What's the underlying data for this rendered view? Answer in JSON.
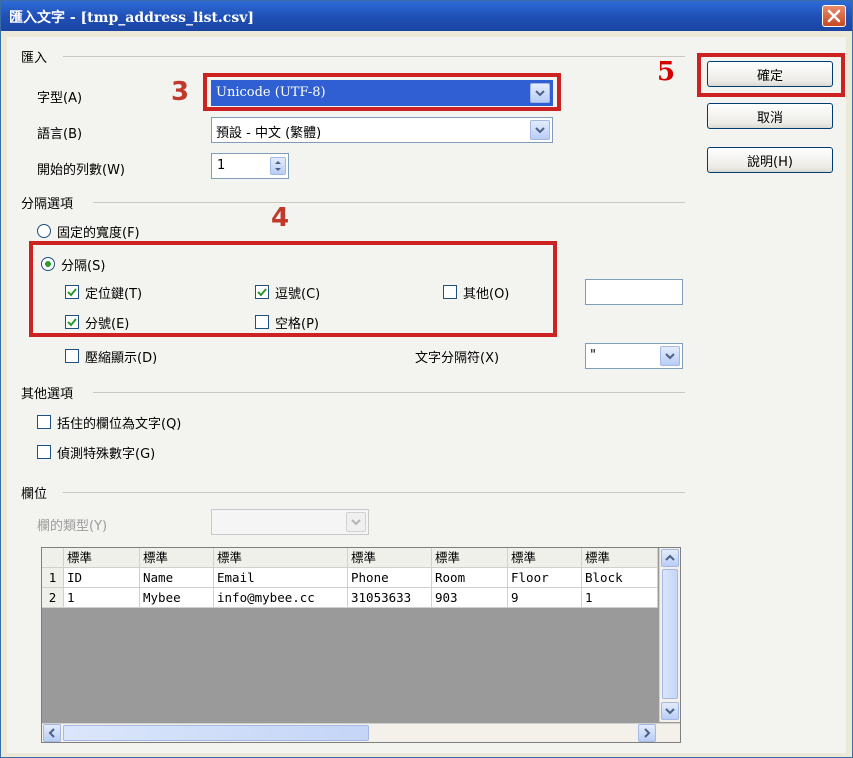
{
  "window": {
    "title": "匯入文字 - [tmp_address_list.csv]",
    "close_icon": "close-icon"
  },
  "import_section": {
    "label": "匯入",
    "charset_label": "字型(A)",
    "charset_value": "Unicode (UTF-8)",
    "language_label": "語言(B)",
    "language_value": "預設 - 中文 (繁體)",
    "from_row_label": "開始的列數(W)",
    "from_row_value": "1"
  },
  "separator_section": {
    "label": "分隔選項",
    "fixed_width_label": "固定的寬度(F)",
    "separated_by_label": "分隔(S)",
    "tab_label": "定位鍵(T)",
    "comma_label": "逗號(C)",
    "other_label": "其他(O)",
    "semicolon_label": "分號(E)",
    "space_label": "空格(P)",
    "merge_label": "壓縮顯示(D)",
    "text_delimiter_label": "文字分隔符(X)",
    "text_delimiter_value": "\"",
    "other_value": "",
    "states": {
      "fixed_width": false,
      "separated_by": true,
      "tab": true,
      "comma": true,
      "other": false,
      "semicolon": true,
      "space": false,
      "merge": false
    }
  },
  "other_options": {
    "label": "其他選項",
    "quoted_as_text_label": "括住的欄位為文字(Q)",
    "detect_special_label": "偵測特殊數字(G)",
    "states": {
      "quoted_as_text": false,
      "detect_special": false
    }
  },
  "fields": {
    "label": "欄位",
    "column_type_label": "欄的類型(Y)",
    "column_type_value": ""
  },
  "buttons": {
    "ok": "確定",
    "cancel": "取消",
    "help": "說明(H)"
  },
  "annotations": {
    "n3": "3",
    "n4": "4",
    "n5": "5"
  },
  "preview": {
    "headers": [
      "標準",
      "標準",
      "標準",
      "標準",
      "標準",
      "標準",
      "標準"
    ],
    "rows": [
      {
        "num": "1",
        "cells": [
          "ID",
          "Name",
          "Email",
          "Phone",
          "Room",
          "Floor",
          "Block"
        ]
      },
      {
        "num": "2",
        "cells": [
          "1",
          "Mybee",
          "info@mybee.cc",
          "31053633",
          "903",
          "9",
          "1"
        ]
      }
    ]
  },
  "colors": {
    "annotation_red": "#cc2222",
    "titlebar": "#1f4fb5",
    "check_green": "#2b9a2b"
  }
}
